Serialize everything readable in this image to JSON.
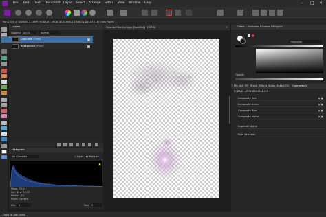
{
  "menu": {
    "items": [
      "File",
      "Edit",
      "Text",
      "Document",
      "Layer",
      "Select",
      "Arrange",
      "Filters",
      "View",
      "Window",
      "Help"
    ],
    "window_controls": [
      "–",
      "□",
      "✕"
    ]
  },
  "toolbar": {
    "persona_icons": [
      "photo-persona-icon",
      "liquify-persona-icon",
      "develop-persona-icon",
      "tone-mapping-persona-icon",
      "export-persona-icon"
    ]
  },
  "context": {
    "info": "Pan   1200 × 1800px, 2.16MP, RGBA/8 - sRGB IEC61966-2.1     NIKON D5100 (14)     Units  Pixels"
  },
  "layers_panel": {
    "tabs": [
      "Layers"
    ],
    "opacity_label": "Opacity:",
    "opacity_value": "100 %",
    "blend_mode": "Normal",
    "layers": [
      {
        "name": "Duplicate",
        "type": "(Pixel)",
        "selected": true
      },
      {
        "name": "Background",
        "type": "(Pixel)",
        "selected": false
      }
    ]
  },
  "histogram_panel": {
    "tabs": [
      "Histogram"
    ],
    "channel_select": "All Channels",
    "option_layer": "Layer",
    "option_marquee": "Marquee",
    "stats": {
      "mean": "Mean: 23.01",
      "std_dev": "Std. Dev.: 19.15",
      "median": "Median: 23",
      "pixels": "Pixels: 149999"
    },
    "min_label": "Min",
    "min_value": "0",
    "max_label": "Max",
    "max_value": "0"
  },
  "document": {
    "title": "OrionNetTwenty4.jpg [Modified] (9.53%)"
  },
  "right_panel": {
    "tabs": [
      "Colour",
      "Swatches",
      "Brushes",
      "Navigator"
    ],
    "mode_select": "Greyscale",
    "opacity_label": "Opacity",
    "lower_tabs": [
      "His",
      "Adj",
      "Eff",
      "Stock",
      "Effects",
      "Styles",
      "History",
      "Ch",
      "Channels",
      "Info"
    ],
    "channel_source": "RGBA/8 - sRGB IEC61966-2.1",
    "channels": [
      "Composite Red",
      "Composite Green",
      "Composite Blue",
      "Composite Alpha"
    ],
    "extra_channels": [
      "Duplicate Alpha",
      "Pixel Selection"
    ]
  },
  "status": {
    "text": "Drag to pan view."
  },
  "colors": {
    "accent": "#3e6ea6",
    "app_logo": "#7a1fa2",
    "panel_bg": "#262626",
    "menu_bg": "#2b2b2b",
    "histogram_fill": "#1e3c7a"
  }
}
